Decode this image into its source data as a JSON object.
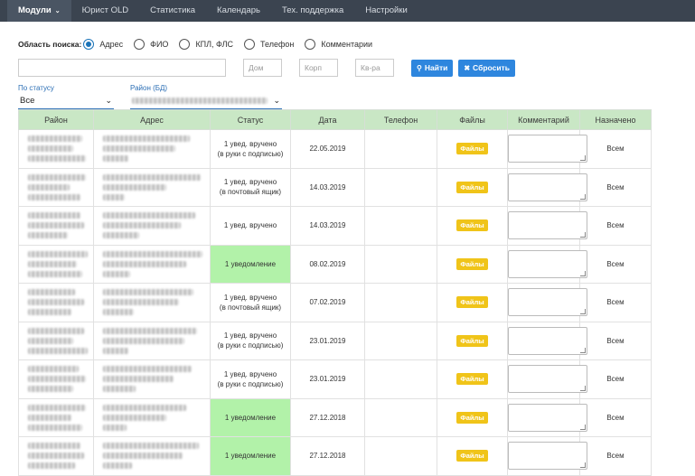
{
  "nav": {
    "items": [
      {
        "label": "Модули",
        "active": true,
        "caret": "⌄"
      },
      {
        "label": "Юрист OLD"
      },
      {
        "label": "Статистика"
      },
      {
        "label": "Календарь"
      },
      {
        "label": "Тех. поддержка"
      },
      {
        "label": "Настройки"
      }
    ]
  },
  "search": {
    "scope_label": "Область поиска:",
    "options": [
      {
        "label": "Адрес",
        "checked": true
      },
      {
        "label": "ФИО"
      },
      {
        "label": "КПЛ, ФЛС"
      },
      {
        "label": "Телефон"
      },
      {
        "label": "Комментарии"
      }
    ],
    "main_input": "",
    "house_placeholder": "Дом",
    "corpus_placeholder": "Корп",
    "apartment_placeholder": "Кв-ра",
    "find_label": "Найти",
    "reset_label": "Сбросить",
    "accent_blue": "#2e86de"
  },
  "filters": {
    "status_label": "По статусу",
    "status_value": "Все",
    "district_label": "Район (БД)"
  },
  "table": {
    "headers": [
      "Район",
      "Адрес",
      "Статус",
      "Дата",
      "Телефон",
      "Файлы",
      "Комментарий",
      "Назначено"
    ],
    "header_color": "#c9e7c5",
    "highlight_color": "#b2f2a9",
    "files_badge_color": "#f0c419",
    "rows": [
      {
        "status_line1": "1 увед. вручено",
        "status_line2": "(в руки с подписью)",
        "green": false,
        "date": "22.05.2019",
        "phone": "",
        "files": "Файлы",
        "assigned": "Всем"
      },
      {
        "status_line1": "1 увед. вручено",
        "status_line2": "(в почтовый ящик)",
        "green": false,
        "date": "14.03.2019",
        "phone": "",
        "files": "Файлы",
        "assigned": "Всем"
      },
      {
        "status_line1": "1 увед. вручено",
        "status_line2": "",
        "green": false,
        "date": "14.03.2019",
        "phone": "",
        "files": "Файлы",
        "assigned": "Всем"
      },
      {
        "status_line1": "1 уведомление",
        "status_line2": "",
        "green": true,
        "date": "08.02.2019",
        "phone": "",
        "files": "Файлы",
        "assigned": "Всем"
      },
      {
        "status_line1": "1 увед. вручено",
        "status_line2": "(в почтовый ящик)",
        "green": false,
        "date": "07.02.2019",
        "phone": "",
        "files": "Файлы",
        "assigned": "Всем"
      },
      {
        "status_line1": "1 увед. вручено",
        "status_line2": "(в руки с подписью)",
        "green": false,
        "date": "23.01.2019",
        "phone": "",
        "files": "Файлы",
        "assigned": "Всем"
      },
      {
        "status_line1": "1 увед. вручено",
        "status_line2": "(в руки с подписью)",
        "green": false,
        "date": "23.01.2019",
        "phone": "",
        "files": "Файлы",
        "assigned": "Всем"
      },
      {
        "status_line1": "1 уведомление",
        "status_line2": "",
        "green": true,
        "date": "27.12.2018",
        "phone": "",
        "files": "Файлы",
        "assigned": "Всем"
      },
      {
        "status_line1": "1 уведомление",
        "status_line2": "",
        "green": true,
        "date": "27.12.2018",
        "phone": "",
        "files": "Файлы",
        "assigned": "Всем"
      }
    ]
  }
}
